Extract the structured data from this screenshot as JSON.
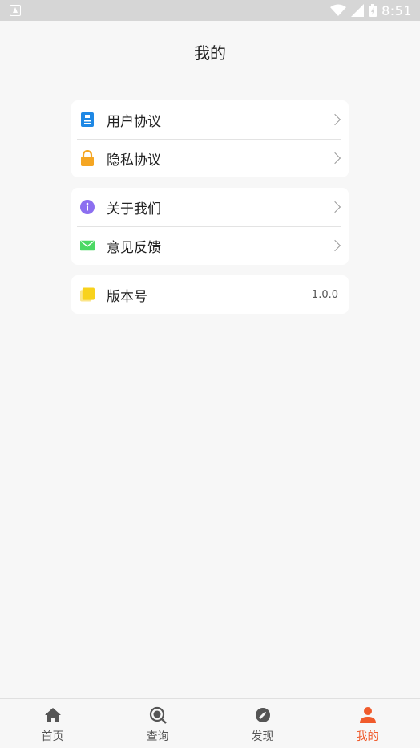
{
  "status_bar": {
    "time": "8:51"
  },
  "header": {
    "title": "我的"
  },
  "groups": [
    {
      "items": [
        {
          "label": "用户协议",
          "icon": "document-icon",
          "color": "#1e88e5"
        },
        {
          "label": "隐私协议",
          "icon": "lock-icon",
          "color": "#f5a623"
        }
      ]
    },
    {
      "items": [
        {
          "label": "关于我们",
          "icon": "info-icon",
          "color": "#8c6ff0"
        },
        {
          "label": "意见反馈",
          "icon": "mail-icon",
          "color": "#4cd964"
        }
      ]
    },
    {
      "items": [
        {
          "label": "版本号",
          "icon": "stack-icon",
          "color": "#f8d21c",
          "value": "1.0.0"
        }
      ]
    }
  ],
  "bottom_nav": {
    "items": [
      {
        "label": "首页",
        "icon": "home-icon"
      },
      {
        "label": "查询",
        "icon": "search-icon"
      },
      {
        "label": "发现",
        "icon": "discover-icon"
      },
      {
        "label": "我的",
        "icon": "person-icon",
        "active": true
      }
    ],
    "active_color": "#f05a2b"
  }
}
